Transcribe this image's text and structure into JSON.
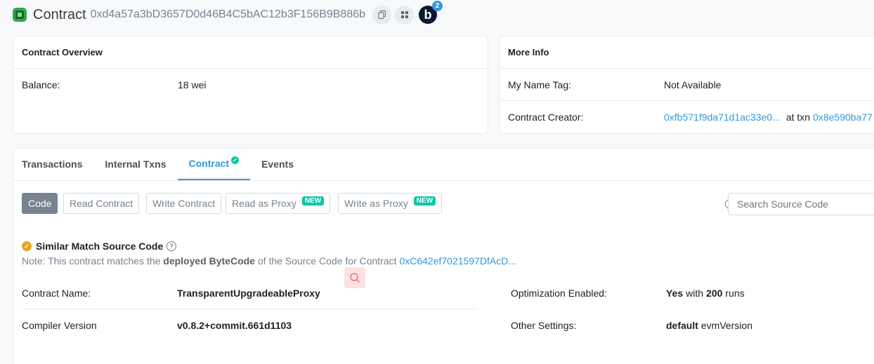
{
  "header": {
    "title": "Contract",
    "address": "0xd4a57a3bD3657D0d46B4C5bAC12b3F156B9B886b",
    "badge_letter": "b",
    "badge_count": "2"
  },
  "overview": {
    "heading": "Contract Overview",
    "balance_label": "Balance:",
    "balance_value": "18 wei"
  },
  "more_info": {
    "heading": "More Info",
    "name_tag_label": "My Name Tag:",
    "name_tag_value": "Not Available",
    "creator_label": "Contract Creator:",
    "creator_address": "0xfb571f9da71d1ac33e0...",
    "at_txn_label": "at txn",
    "txn_hash": "0x8e590ba77"
  },
  "tabs": [
    {
      "label": "Transactions"
    },
    {
      "label": "Internal Txns"
    },
    {
      "label": "Contract"
    },
    {
      "label": "Events"
    }
  ],
  "code_buttons": {
    "code": "Code",
    "read_contract": "Read Contract",
    "write_contract": "Write Contract",
    "read_proxy": "Read as Proxy",
    "write_proxy": "Write as Proxy",
    "new_badge": "NEW"
  },
  "search": {
    "placeholder": "Search Source Code"
  },
  "source": {
    "match_title": "Similar Match Source Code",
    "note_prefix": "Note: This contract matches the",
    "note_bold": "deployed ByteCode",
    "note_middle": "of the Source Code for Contract",
    "note_link": "0xC642ef7021597DfAcD..."
  },
  "details": {
    "contract_name_label": "Contract Name:",
    "contract_name_value": "TransparentUpgradeableProxy",
    "compiler_label": "Compiler Version",
    "compiler_value": "v0.8.2+commit.661d1103",
    "optimization_label": "Optimization Enabled:",
    "optimization_yes": "Yes",
    "optimization_with": "with",
    "optimization_runs_num": "200",
    "optimization_runs_word": "runs",
    "other_label": "Other Settings:",
    "other_value_bold": "default",
    "other_value_rest": "evmVersion"
  }
}
